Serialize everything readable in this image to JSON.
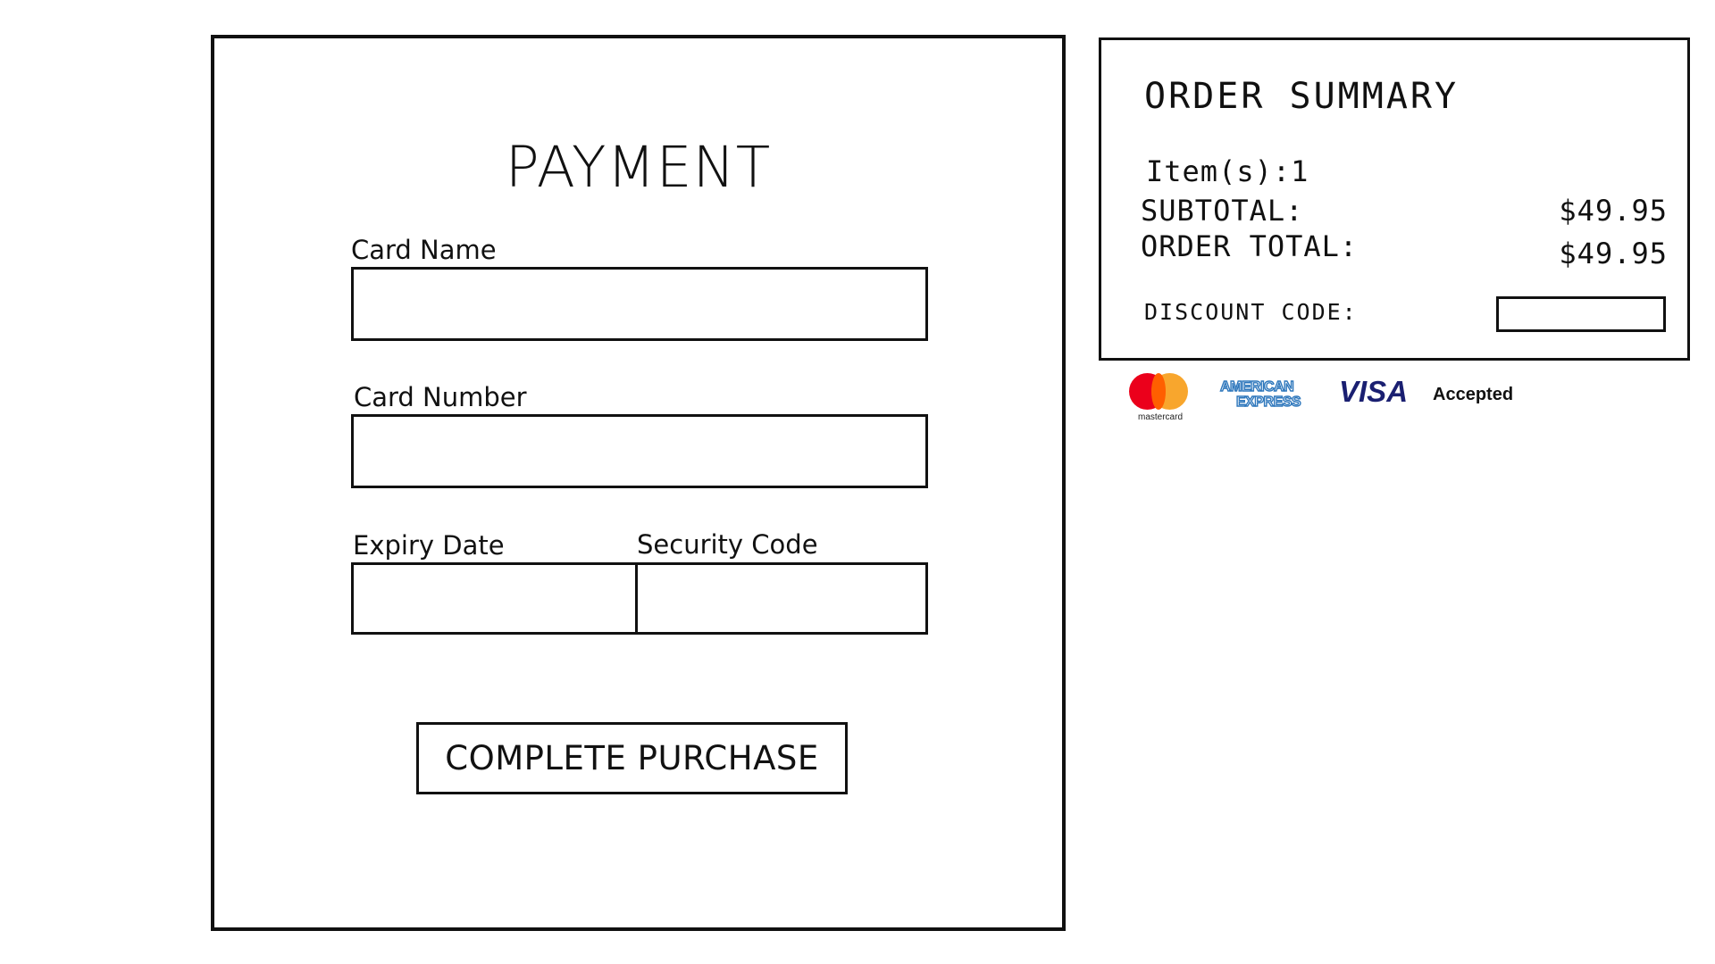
{
  "payment": {
    "title": "PAYMENT",
    "card_name": {
      "label": "Card Name",
      "value": ""
    },
    "card_number": {
      "label": "Card Number",
      "value": ""
    },
    "expiry_date": {
      "label": "Expiry Date",
      "value": ""
    },
    "security_code": {
      "label": "Security Code",
      "value": ""
    },
    "complete_button_label": "COMPLETE PURCHASE"
  },
  "order_summary": {
    "title": "ORDER SUMMARY",
    "items_label": "Item(s):1",
    "subtotal_label": "SUBTOTAL:",
    "subtotal_value": "$49.95",
    "order_total_label": "ORDER TOTAL:",
    "order_total_value": "$49.95",
    "discount_label": "DISCOUNT CODE:",
    "discount_value": ""
  },
  "accepted_cards": {
    "mastercard_text": "mastercard",
    "amex_line1": "AMERICAN",
    "amex_line2": "EXPRESS",
    "visa_text": "VISA",
    "accepted_label": "Accepted",
    "icons": [
      "mastercard-icon",
      "american-express-icon",
      "visa-icon"
    ],
    "colors": {
      "mastercard_red": "#eb001b",
      "mastercard_orange": "#f79e1b",
      "amex_blue": "#2e77bc",
      "visa_blue": "#1a1f71"
    }
  }
}
